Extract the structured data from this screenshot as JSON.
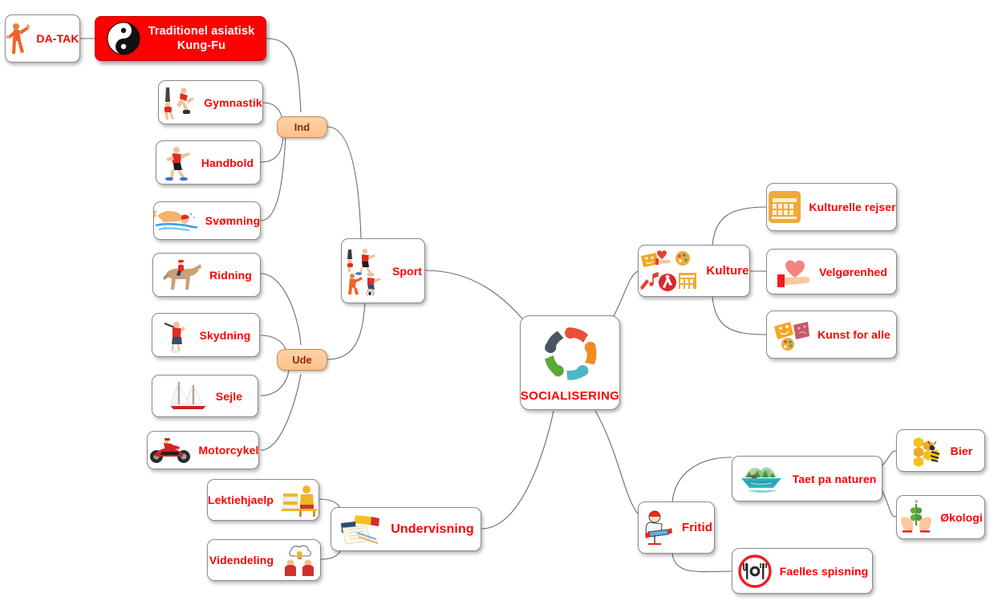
{
  "title": "SOCIALISERING mind map",
  "colors": {
    "node_text": "#ff0000",
    "root_bg": "#ff0000",
    "root_text": "#ffffff",
    "pill_bg": "#ffc08a",
    "pill_text": "#8a2b10",
    "edge": "#6b6b6b",
    "canvas_bg": "#ffffff"
  },
  "center": {
    "label": "SOCIALISERING",
    "icon": "people-circle-icon"
  },
  "root": {
    "label": "Traditionel asiatisk Kung-Fu",
    "line1": "Traditionel asiatisk",
    "line2": "Kung-Fu",
    "icon": "yin-yang-icon"
  },
  "datak": {
    "label": "DA-TAK",
    "icon": "kungfu-person-icon"
  },
  "connectors": [
    {
      "label": "Ind"
    },
    {
      "label": "Ude"
    }
  ],
  "branches": {
    "sport": {
      "label": "Sport",
      "icon": "sport-athletes-icon",
      "ind": {
        "label": "Ind",
        "items": [
          {
            "label": "Gymnastik",
            "icon": "gymnast-icon"
          },
          {
            "label": "Handbold",
            "icon": "handball-player-icon"
          },
          {
            "label": "Svømning",
            "icon": "swimmer-icon"
          }
        ]
      },
      "ude": {
        "label": "Ude",
        "items": [
          {
            "label": "Ridning",
            "icon": "horse-riding-icon"
          },
          {
            "label": "Skydning",
            "icon": "shooting-icon"
          },
          {
            "label": "Sejle",
            "icon": "sailboat-icon"
          },
          {
            "label": "Motorcykel",
            "icon": "motorcycle-icon"
          }
        ]
      }
    },
    "undervisning": {
      "label": "Undervisning",
      "icon": "books-notebook-icon",
      "items": [
        {
          "label": "Lektiehjaelp",
          "icon": "tutor-books-icon"
        },
        {
          "label": "Videndeling",
          "icon": "knowledge-sharing-icon"
        }
      ]
    },
    "kulture": {
      "label": "Kulture",
      "icon": "culture-collage-icon",
      "items": [
        {
          "label": "Kulturelle rejser",
          "icon": "colosseum-icon"
        },
        {
          "label": "Velgørenhed",
          "icon": "heart-in-hand-icon"
        },
        {
          "label": "Kunst for alle",
          "icon": "theatre-masks-palette-icon"
        }
      ]
    },
    "fritid": {
      "label": "Fritid",
      "icon": "person-relaxing-icon",
      "items": [
        {
          "label": "Taet pa naturen",
          "icon": "nature-lake-icon",
          "items": [
            {
              "label": "Bier",
              "icon": "bee-honeycomb-icon"
            },
            {
              "label": "Økologi",
              "icon": "plant-in-hands-icon"
            }
          ]
        },
        {
          "label": "Faelles spisning",
          "icon": "restaurant-sign-icon"
        }
      ]
    }
  }
}
